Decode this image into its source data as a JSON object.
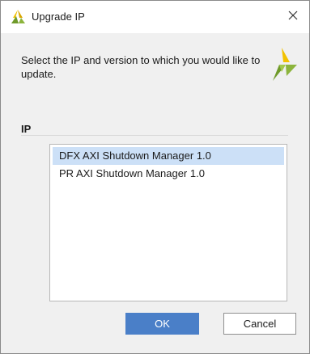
{
  "window": {
    "title": "Upgrade IP",
    "close_glyph": "✕"
  },
  "header": {
    "instructions": "Select the IP and version to which you would like to update.",
    "logo_icon": "xilinx-logo-icon"
  },
  "section": {
    "label": "IP"
  },
  "ip_list": {
    "items": [
      {
        "label": "DFX AXI Shutdown Manager  1.0",
        "selected": true
      },
      {
        "label": "PR AXI Shutdown Manager  1.0",
        "selected": false
      }
    ]
  },
  "buttons": {
    "ok_label": "OK",
    "cancel_label": "Cancel"
  },
  "colors": {
    "accent": "#4a7fc8",
    "selection": "#cce0f7",
    "logo_green": "#8cb43c",
    "logo_yellow": "#f2c200"
  }
}
